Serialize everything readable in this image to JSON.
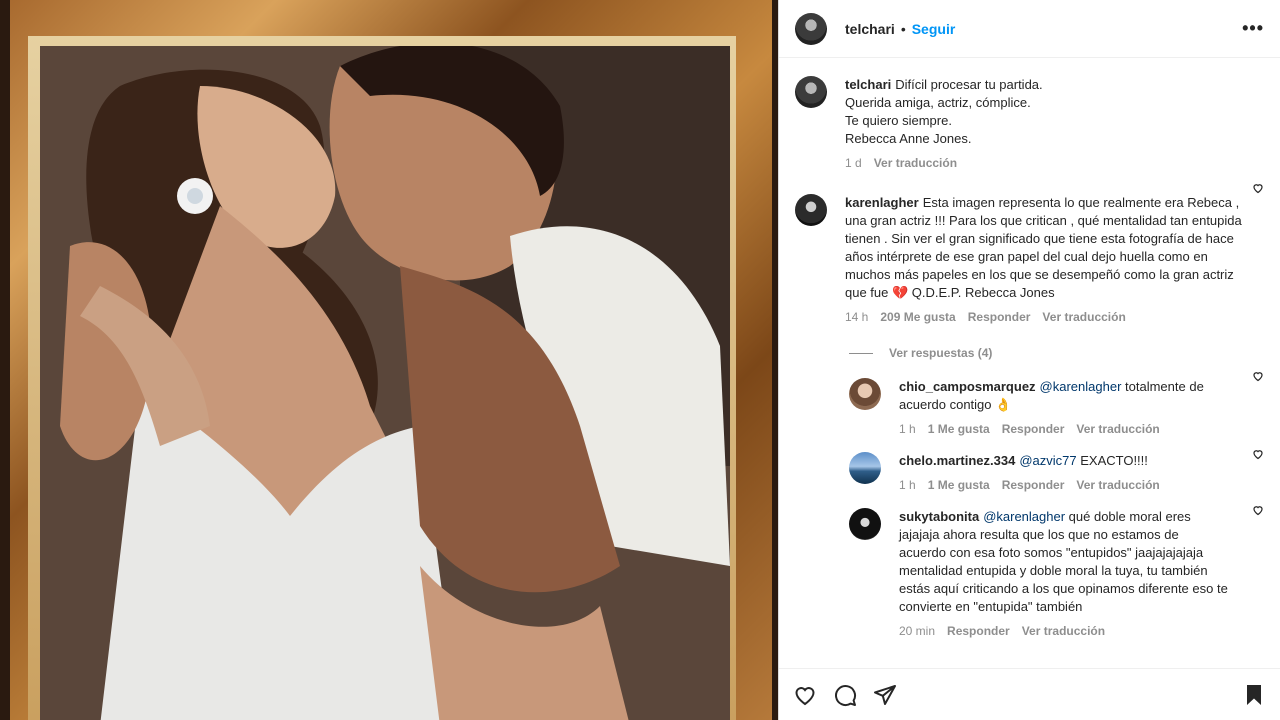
{
  "post": {
    "username": "telchari",
    "follow_label": "Seguir",
    "more_label": "•••",
    "caption_lines": [
      "Difícil procesar tu partida.",
      "Querida amiga, actriz, cómplice.",
      "Te quiero siempre.",
      "Rebecca Anne Jones."
    ],
    "caption_time": "1 d",
    "caption_translate": "Ver traducción"
  },
  "comments": [
    {
      "username": "karenlagher",
      "text": "Esta imagen representa lo que realmente era Rebeca , una gran actriz !!! Para los que critican , qué mentalidad tan entupida tienen . Sin ver el gran significado que tiene esta fotografía de hace años intérprete de ese gran papel del cual dejo huella como en muchos más papeles en los que se desempeñó como la gran actriz que fue 💔 Q.D.E.P. Rebecca Jones",
      "time": "14 h",
      "likes": "209 Me gusta",
      "reply": "Responder",
      "translate": "Ver traducción",
      "view_replies": "Ver respuestas (4)"
    }
  ],
  "replies": [
    {
      "username": "chio_camposmarquez",
      "mention": "@karenlagher",
      "text": " totalmente de acuerdo contigo 👌",
      "time": "1 h",
      "likes": "1 Me gusta",
      "reply": "Responder",
      "translate": "Ver traducción"
    },
    {
      "username": "chelo.martinez.334",
      "mention": "@azvic77",
      "text": " EXACTO!!!!",
      "time": "1 h",
      "likes": "1 Me gusta",
      "reply": "Responder",
      "translate": "Ver traducción"
    },
    {
      "username": "sukytabonita",
      "mention": "@karenlagher",
      "text": " qué doble moral eres jajajaja ahora resulta que los que no estamos de acuerdo con esa foto somos \"entupidos\" jaajajajajaja mentalidad entupida y doble moral la tuya, tu también estás aquí criticando a los que opinamos diferente eso te convierte en \"entupida\" también",
      "time": "20 min",
      "reply": "Responder",
      "translate": "Ver traducción"
    }
  ],
  "colors": {
    "accent": "#0095f6",
    "muted": "#8e8e8e",
    "text": "#262626",
    "mention": "#00376b"
  },
  "icons": [
    "heart-icon",
    "comment-icon",
    "share-icon",
    "bookmark-icon",
    "more-icon"
  ]
}
